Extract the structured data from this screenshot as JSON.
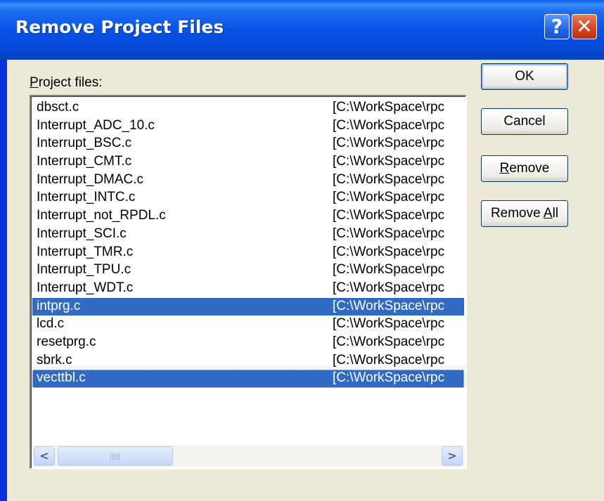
{
  "dialog": {
    "title": "Remove Project Files",
    "help_glyph": "?",
    "close_glyph": "✕"
  },
  "files_label": "Project files:",
  "files": [
    {
      "name": "dbsct.c",
      "path": "[C:\\WorkSpace\\rpc",
      "selected": false
    },
    {
      "name": "Interrupt_ADC_10.c",
      "path": "[C:\\WorkSpace\\rpc",
      "selected": false
    },
    {
      "name": "Interrupt_BSC.c",
      "path": "[C:\\WorkSpace\\rpc",
      "selected": false
    },
    {
      "name": "Interrupt_CMT.c",
      "path": "[C:\\WorkSpace\\rpc",
      "selected": false
    },
    {
      "name": "Interrupt_DMAC.c",
      "path": "[C:\\WorkSpace\\rpc",
      "selected": false
    },
    {
      "name": "Interrupt_INTC.c",
      "path": "[C:\\WorkSpace\\rpc",
      "selected": false
    },
    {
      "name": "Interrupt_not_RPDL.c",
      "path": "[C:\\WorkSpace\\rpc",
      "selected": false
    },
    {
      "name": "Interrupt_SCI.c",
      "path": "[C:\\WorkSpace\\rpc",
      "selected": false
    },
    {
      "name": "Interrupt_TMR.c",
      "path": "[C:\\WorkSpace\\rpc",
      "selected": false
    },
    {
      "name": "Interrupt_TPU.c",
      "path": "[C:\\WorkSpace\\rpc",
      "selected": false
    },
    {
      "name": "Interrupt_WDT.c",
      "path": "[C:\\WorkSpace\\rpc",
      "selected": false
    },
    {
      "name": "intprg.c",
      "path": "[C:\\WorkSpace\\rpc",
      "selected": true
    },
    {
      "name": "lcd.c",
      "path": "[C:\\WorkSpace\\rpc",
      "selected": false
    },
    {
      "name": "resetprg.c",
      "path": "[C:\\WorkSpace\\rpc",
      "selected": false
    },
    {
      "name": "sbrk.c",
      "path": "[C:\\WorkSpace\\rpc",
      "selected": false
    },
    {
      "name": "vecttbl.c",
      "path": "[C:\\WorkSpace\\rpc",
      "selected": true,
      "focused": true
    }
  ],
  "scrollbar": {
    "left_arrow": "<",
    "right_arrow": ">"
  },
  "buttons": {
    "ok": "OK",
    "cancel": "Cancel",
    "remove": "Remove",
    "remove_all": "Remove All"
  },
  "colors": {
    "selection": "#316ac5",
    "dialog_face": "#ece9d8",
    "titlebar": "#0853e6"
  }
}
